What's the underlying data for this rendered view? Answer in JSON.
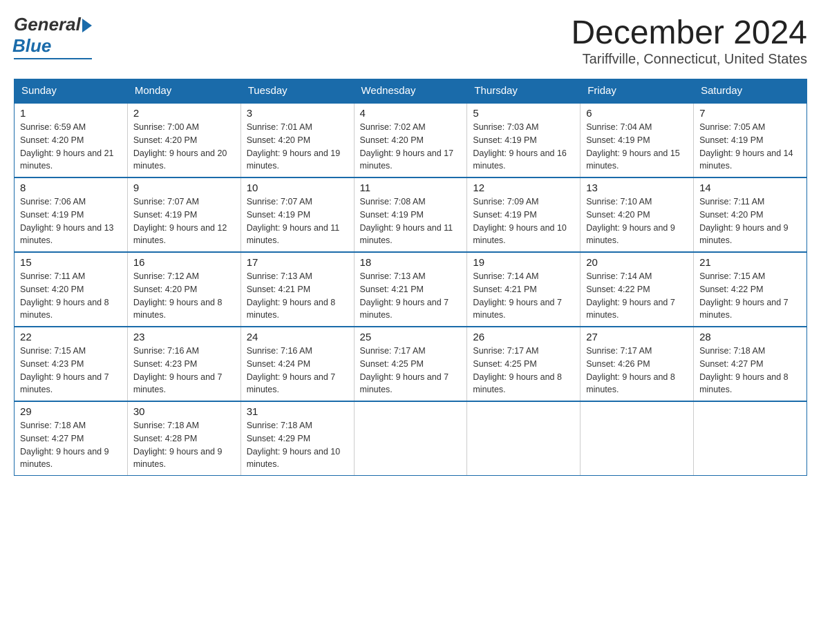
{
  "header": {
    "logo": {
      "general": "General",
      "blue": "Blue"
    },
    "title": "December 2024",
    "location": "Tariffville, Connecticut, United States"
  },
  "days_of_week": [
    "Sunday",
    "Monday",
    "Tuesday",
    "Wednesday",
    "Thursday",
    "Friday",
    "Saturday"
  ],
  "weeks": [
    [
      {
        "day": "1",
        "sunrise": "6:59 AM",
        "sunset": "4:20 PM",
        "daylight": "9 hours and 21 minutes."
      },
      {
        "day": "2",
        "sunrise": "7:00 AM",
        "sunset": "4:20 PM",
        "daylight": "9 hours and 20 minutes."
      },
      {
        "day": "3",
        "sunrise": "7:01 AM",
        "sunset": "4:20 PM",
        "daylight": "9 hours and 19 minutes."
      },
      {
        "day": "4",
        "sunrise": "7:02 AM",
        "sunset": "4:20 PM",
        "daylight": "9 hours and 17 minutes."
      },
      {
        "day": "5",
        "sunrise": "7:03 AM",
        "sunset": "4:19 PM",
        "daylight": "9 hours and 16 minutes."
      },
      {
        "day": "6",
        "sunrise": "7:04 AM",
        "sunset": "4:19 PM",
        "daylight": "9 hours and 15 minutes."
      },
      {
        "day": "7",
        "sunrise": "7:05 AM",
        "sunset": "4:19 PM",
        "daylight": "9 hours and 14 minutes."
      }
    ],
    [
      {
        "day": "8",
        "sunrise": "7:06 AM",
        "sunset": "4:19 PM",
        "daylight": "9 hours and 13 minutes."
      },
      {
        "day": "9",
        "sunrise": "7:07 AM",
        "sunset": "4:19 PM",
        "daylight": "9 hours and 12 minutes."
      },
      {
        "day": "10",
        "sunrise": "7:07 AM",
        "sunset": "4:19 PM",
        "daylight": "9 hours and 11 minutes."
      },
      {
        "day": "11",
        "sunrise": "7:08 AM",
        "sunset": "4:19 PM",
        "daylight": "9 hours and 11 minutes."
      },
      {
        "day": "12",
        "sunrise": "7:09 AM",
        "sunset": "4:19 PM",
        "daylight": "9 hours and 10 minutes."
      },
      {
        "day": "13",
        "sunrise": "7:10 AM",
        "sunset": "4:20 PM",
        "daylight": "9 hours and 9 minutes."
      },
      {
        "day": "14",
        "sunrise": "7:11 AM",
        "sunset": "4:20 PM",
        "daylight": "9 hours and 9 minutes."
      }
    ],
    [
      {
        "day": "15",
        "sunrise": "7:11 AM",
        "sunset": "4:20 PM",
        "daylight": "9 hours and 8 minutes."
      },
      {
        "day": "16",
        "sunrise": "7:12 AM",
        "sunset": "4:20 PM",
        "daylight": "9 hours and 8 minutes."
      },
      {
        "day": "17",
        "sunrise": "7:13 AM",
        "sunset": "4:21 PM",
        "daylight": "9 hours and 8 minutes."
      },
      {
        "day": "18",
        "sunrise": "7:13 AM",
        "sunset": "4:21 PM",
        "daylight": "9 hours and 7 minutes."
      },
      {
        "day": "19",
        "sunrise": "7:14 AM",
        "sunset": "4:21 PM",
        "daylight": "9 hours and 7 minutes."
      },
      {
        "day": "20",
        "sunrise": "7:14 AM",
        "sunset": "4:22 PM",
        "daylight": "9 hours and 7 minutes."
      },
      {
        "day": "21",
        "sunrise": "7:15 AM",
        "sunset": "4:22 PM",
        "daylight": "9 hours and 7 minutes."
      }
    ],
    [
      {
        "day": "22",
        "sunrise": "7:15 AM",
        "sunset": "4:23 PM",
        "daylight": "9 hours and 7 minutes."
      },
      {
        "day": "23",
        "sunrise": "7:16 AM",
        "sunset": "4:23 PM",
        "daylight": "9 hours and 7 minutes."
      },
      {
        "day": "24",
        "sunrise": "7:16 AM",
        "sunset": "4:24 PM",
        "daylight": "9 hours and 7 minutes."
      },
      {
        "day": "25",
        "sunrise": "7:17 AM",
        "sunset": "4:25 PM",
        "daylight": "9 hours and 7 minutes."
      },
      {
        "day": "26",
        "sunrise": "7:17 AM",
        "sunset": "4:25 PM",
        "daylight": "9 hours and 8 minutes."
      },
      {
        "day": "27",
        "sunrise": "7:17 AM",
        "sunset": "4:26 PM",
        "daylight": "9 hours and 8 minutes."
      },
      {
        "day": "28",
        "sunrise": "7:18 AM",
        "sunset": "4:27 PM",
        "daylight": "9 hours and 8 minutes."
      }
    ],
    [
      {
        "day": "29",
        "sunrise": "7:18 AM",
        "sunset": "4:27 PM",
        "daylight": "9 hours and 9 minutes."
      },
      {
        "day": "30",
        "sunrise": "7:18 AM",
        "sunset": "4:28 PM",
        "daylight": "9 hours and 9 minutes."
      },
      {
        "day": "31",
        "sunrise": "7:18 AM",
        "sunset": "4:29 PM",
        "daylight": "9 hours and 10 minutes."
      },
      null,
      null,
      null,
      null
    ]
  ]
}
